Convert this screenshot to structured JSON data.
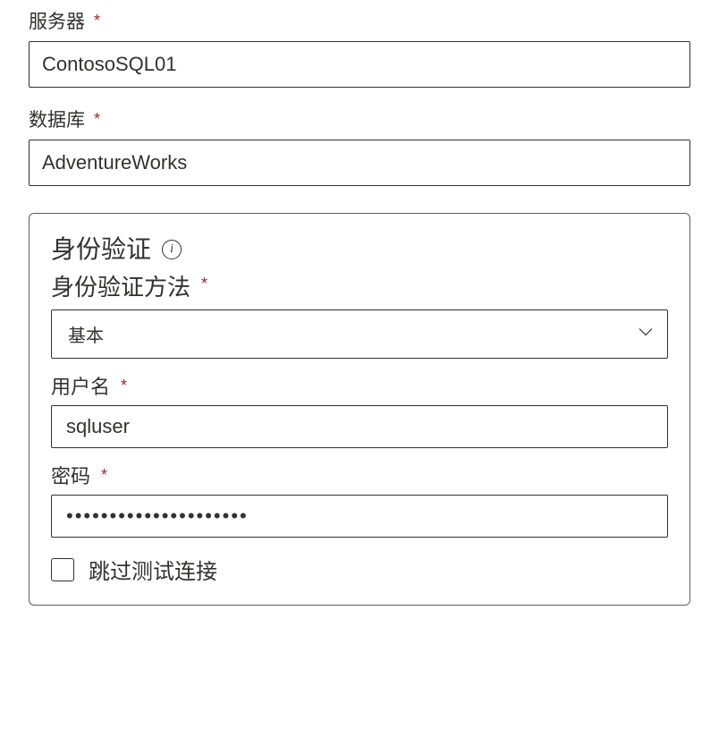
{
  "server": {
    "label": "服务器",
    "value": "ContosoSQL01"
  },
  "database": {
    "label": "数据库",
    "value": "AdventureWorks"
  },
  "auth": {
    "section_title": "身份验证",
    "method_label": "身份验证方法",
    "method_selected": "基本",
    "username_label": "用户名",
    "username_value": "sqluser",
    "password_label": "密码",
    "password_value": "•••••••••••••••••••••",
    "skip_test_label": "跳过测试连接",
    "skip_test_checked": false
  },
  "required_glyph": "*",
  "info_glyph": "i"
}
